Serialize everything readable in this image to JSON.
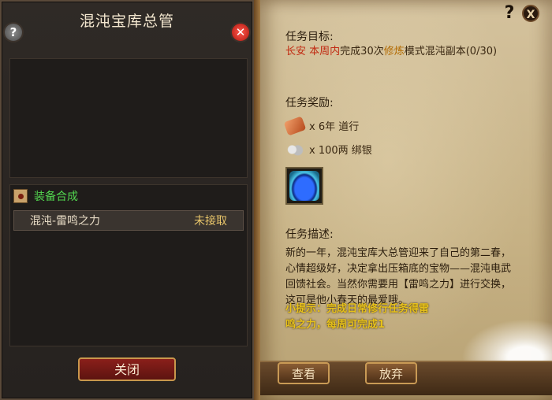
{
  "left_panel": {
    "title": "混沌宝库总管",
    "help_icon": "?",
    "category": "装备合成",
    "task": {
      "name": "混沌-雷鸣之力",
      "status": "未接取"
    },
    "close_button": "关闭"
  },
  "quest": {
    "top_icons": {
      "help": "?",
      "close": "X"
    },
    "goal_heading": "任务目标:",
    "goal": {
      "location": "长安",
      "week": "本周内",
      "text1": "完成30次",
      "mode": "修炼",
      "text2": "模式混沌副本(0/30)"
    },
    "reward_heading": "任务奖励:",
    "rewards": [
      {
        "icon": "scroll-icon",
        "text": "x 6年  道行"
      },
      {
        "icon": "silver-icon",
        "text": "x 100两  绑银"
      }
    ],
    "desc_heading": "任务描述:",
    "desc": "新的一年，混沌宝库大总管迎来了自己的第二春，心情超级好，决定拿出压箱底的宝物——混沌电武回馈社会。当然你需要用【雷鸣之力】进行交换，这可是他小春天的最爱哦。",
    "tip": "小提示：完成日常修行任务得雷鸣之力，每周可完成1",
    "buttons": {
      "view": "查看",
      "abandon": "放弃"
    }
  }
}
